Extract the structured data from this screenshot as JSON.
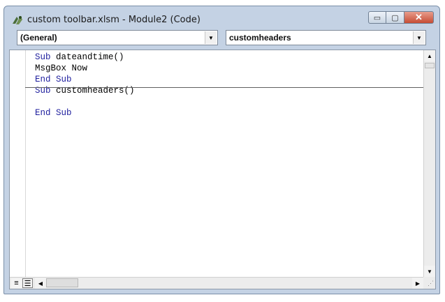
{
  "window": {
    "title": "custom toolbar.xlsm - Module2 (Code)",
    "buttons": {
      "minimize": "▭",
      "maximize": "▢",
      "close": "✕"
    }
  },
  "combos": {
    "object": "(General)",
    "procedure": "customheaders"
  },
  "code_lines": [
    {
      "kw": "Sub",
      "rest": " dateandtime()"
    },
    {
      "kw": "",
      "rest": "MsgBox Now"
    },
    {
      "kw": "End Sub",
      "rest": ""
    },
    {
      "kw": "Sub",
      "rest": " customheaders()"
    },
    {
      "kw": "",
      "rest": ""
    },
    {
      "kw": "End Sub",
      "rest": ""
    }
  ],
  "colors": {
    "keyword": "#1f1f9e",
    "window_frame": "#c4d2e4",
    "close_button": "#c74d35"
  },
  "icons": [
    "app-icon",
    "dropdown-arrow-icon",
    "scroll-up-icon",
    "scroll-down-icon",
    "scroll-left-icon",
    "scroll-right-icon",
    "procedure-view-icon",
    "full-module-view-icon",
    "resize-grip-icon"
  ]
}
